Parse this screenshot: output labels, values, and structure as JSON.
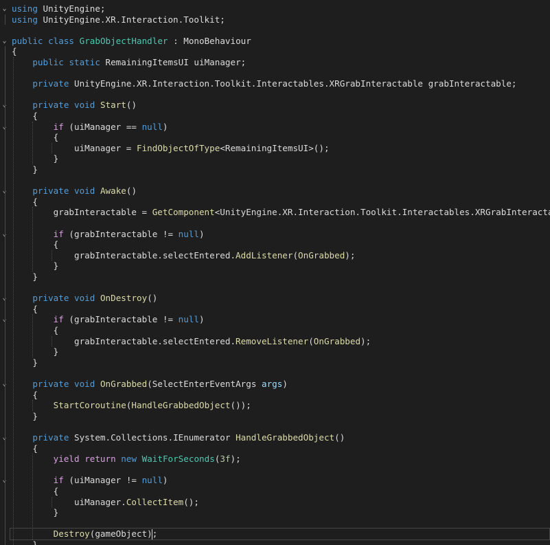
{
  "editor": {
    "lines": [
      {
        "fold": true,
        "tokens": [
          {
            "t": "using",
            "c": "kw"
          },
          {
            "t": " UnityEngine;",
            "c": "pl"
          }
        ]
      },
      {
        "tokens": [
          {
            "t": "using",
            "c": "kw"
          },
          {
            "t": " UnityEngine.XR.Interaction.Toolkit;",
            "c": "pl"
          }
        ]
      },
      {
        "tokens": []
      },
      {
        "fold": true,
        "tokens": [
          {
            "t": "public",
            "c": "kw"
          },
          {
            "t": " ",
            "c": "pl"
          },
          {
            "t": "class",
            "c": "kw"
          },
          {
            "t": " ",
            "c": "pl"
          },
          {
            "t": "GrabObjectHandler",
            "c": "type"
          },
          {
            "t": " : MonoBehaviour",
            "c": "pl"
          }
        ]
      },
      {
        "tokens": [
          {
            "t": "{",
            "c": "pl"
          }
        ]
      },
      {
        "tokens": [
          {
            "t": "    ",
            "c": "pl"
          },
          {
            "t": "public",
            "c": "kw"
          },
          {
            "t": " ",
            "c": "pl"
          },
          {
            "t": "static",
            "c": "kw"
          },
          {
            "t": " RemainingItemsUI uiManager;",
            "c": "pl"
          }
        ]
      },
      {
        "tokens": []
      },
      {
        "tokens": [
          {
            "t": "    ",
            "c": "pl"
          },
          {
            "t": "private",
            "c": "kw"
          },
          {
            "t": " UnityEngine.XR.Interaction.Toolkit.Interactables.XRGrabInteractable grabInteractable;",
            "c": "pl"
          }
        ]
      },
      {
        "tokens": []
      },
      {
        "fold": true,
        "tokens": [
          {
            "t": "    ",
            "c": "pl"
          },
          {
            "t": "private",
            "c": "kw"
          },
          {
            "t": " ",
            "c": "pl"
          },
          {
            "t": "void",
            "c": "kw"
          },
          {
            "t": " ",
            "c": "pl"
          },
          {
            "t": "Start",
            "c": "mth"
          },
          {
            "t": "()",
            "c": "pl"
          }
        ]
      },
      {
        "tokens": [
          {
            "t": "    {",
            "c": "pl"
          }
        ]
      },
      {
        "fold": true,
        "tokens": [
          {
            "t": "        ",
            "c": "pl"
          },
          {
            "t": "if",
            "c": "kw2"
          },
          {
            "t": " (uiManager == ",
            "c": "pl"
          },
          {
            "t": "null",
            "c": "kw"
          },
          {
            "t": ")",
            "c": "pl"
          }
        ]
      },
      {
        "tokens": [
          {
            "t": "        {",
            "c": "pl"
          }
        ]
      },
      {
        "tokens": [
          {
            "t": "            uiManager = ",
            "c": "pl"
          },
          {
            "t": "FindObjectOfType",
            "c": "mth"
          },
          {
            "t": "<RemainingItemsUI>();",
            "c": "pl"
          }
        ]
      },
      {
        "tokens": [
          {
            "t": "        }",
            "c": "pl"
          }
        ]
      },
      {
        "tokens": [
          {
            "t": "    }",
            "c": "pl"
          }
        ]
      },
      {
        "tokens": []
      },
      {
        "fold": true,
        "tokens": [
          {
            "t": "    ",
            "c": "pl"
          },
          {
            "t": "private",
            "c": "kw"
          },
          {
            "t": " ",
            "c": "pl"
          },
          {
            "t": "void",
            "c": "kw"
          },
          {
            "t": " ",
            "c": "pl"
          },
          {
            "t": "Awake",
            "c": "mth"
          },
          {
            "t": "()",
            "c": "pl"
          }
        ]
      },
      {
        "tokens": [
          {
            "t": "    {",
            "c": "pl"
          }
        ]
      },
      {
        "tokens": [
          {
            "t": "        grabInteractable = ",
            "c": "pl"
          },
          {
            "t": "GetComponent",
            "c": "mth"
          },
          {
            "t": "<UnityEngine.XR.Interaction.Toolkit.Interactables.XRGrabInteractable>();",
            "c": "pl"
          }
        ]
      },
      {
        "tokens": []
      },
      {
        "fold": true,
        "tokens": [
          {
            "t": "        ",
            "c": "pl"
          },
          {
            "t": "if",
            "c": "kw2"
          },
          {
            "t": " (grabInteractable != ",
            "c": "pl"
          },
          {
            "t": "null",
            "c": "kw"
          },
          {
            "t": ")",
            "c": "pl"
          }
        ]
      },
      {
        "tokens": [
          {
            "t": "        {",
            "c": "pl"
          }
        ]
      },
      {
        "tokens": [
          {
            "t": "            grabInteractable.selectEntered.",
            "c": "pl"
          },
          {
            "t": "AddListener",
            "c": "mth"
          },
          {
            "t": "(",
            "c": "pl"
          },
          {
            "t": "OnGrabbed",
            "c": "mth"
          },
          {
            "t": ");",
            "c": "pl"
          }
        ]
      },
      {
        "tokens": [
          {
            "t": "        }",
            "c": "pl"
          }
        ]
      },
      {
        "tokens": [
          {
            "t": "    }",
            "c": "pl"
          }
        ]
      },
      {
        "tokens": []
      },
      {
        "fold": true,
        "tokens": [
          {
            "t": "    ",
            "c": "pl"
          },
          {
            "t": "private",
            "c": "kw"
          },
          {
            "t": " ",
            "c": "pl"
          },
          {
            "t": "void",
            "c": "kw"
          },
          {
            "t": " ",
            "c": "pl"
          },
          {
            "t": "OnDestroy",
            "c": "mth"
          },
          {
            "t": "()",
            "c": "pl"
          }
        ]
      },
      {
        "tokens": [
          {
            "t": "    {",
            "c": "pl"
          }
        ]
      },
      {
        "fold": true,
        "tokens": [
          {
            "t": "        ",
            "c": "pl"
          },
          {
            "t": "if",
            "c": "kw2"
          },
          {
            "t": " (grabInteractable != ",
            "c": "pl"
          },
          {
            "t": "null",
            "c": "kw"
          },
          {
            "t": ")",
            "c": "pl"
          }
        ]
      },
      {
        "tokens": [
          {
            "t": "        {",
            "c": "pl"
          }
        ]
      },
      {
        "tokens": [
          {
            "t": "            grabInteractable.selectEntered.",
            "c": "pl"
          },
          {
            "t": "RemoveListener",
            "c": "mth"
          },
          {
            "t": "(",
            "c": "pl"
          },
          {
            "t": "OnGrabbed",
            "c": "mth"
          },
          {
            "t": ");",
            "c": "pl"
          }
        ]
      },
      {
        "tokens": [
          {
            "t": "        }",
            "c": "pl"
          }
        ]
      },
      {
        "tokens": [
          {
            "t": "    }",
            "c": "pl"
          }
        ]
      },
      {
        "tokens": []
      },
      {
        "fold": true,
        "tokens": [
          {
            "t": "    ",
            "c": "pl"
          },
          {
            "t": "private",
            "c": "kw"
          },
          {
            "t": " ",
            "c": "pl"
          },
          {
            "t": "void",
            "c": "kw"
          },
          {
            "t": " ",
            "c": "pl"
          },
          {
            "t": "OnGrabbed",
            "c": "mth"
          },
          {
            "t": "(SelectEnterEventArgs ",
            "c": "pl"
          },
          {
            "t": "args",
            "c": "param"
          },
          {
            "t": ")",
            "c": "pl"
          }
        ]
      },
      {
        "tokens": [
          {
            "t": "    {",
            "c": "pl"
          }
        ]
      },
      {
        "tokens": [
          {
            "t": "        ",
            "c": "pl"
          },
          {
            "t": "StartCoroutine",
            "c": "mth"
          },
          {
            "t": "(",
            "c": "pl"
          },
          {
            "t": "HandleGrabbedObject",
            "c": "mth"
          },
          {
            "t": "());",
            "c": "pl"
          }
        ]
      },
      {
        "tokens": [
          {
            "t": "    }",
            "c": "pl"
          }
        ]
      },
      {
        "tokens": []
      },
      {
        "fold": true,
        "tokens": [
          {
            "t": "    ",
            "c": "pl"
          },
          {
            "t": "private",
            "c": "kw"
          },
          {
            "t": " System.Collections.IEnumerator ",
            "c": "pl"
          },
          {
            "t": "HandleGrabbedObject",
            "c": "mth"
          },
          {
            "t": "()",
            "c": "pl"
          }
        ]
      },
      {
        "tokens": [
          {
            "t": "    {",
            "c": "pl"
          }
        ]
      },
      {
        "tokens": [
          {
            "t": "        ",
            "c": "pl"
          },
          {
            "t": "yield",
            "c": "kw2"
          },
          {
            "t": " ",
            "c": "pl"
          },
          {
            "t": "return",
            "c": "kw2"
          },
          {
            "t": " ",
            "c": "pl"
          },
          {
            "t": "new",
            "c": "kw"
          },
          {
            "t": " ",
            "c": "pl"
          },
          {
            "t": "WaitForSeconds",
            "c": "type"
          },
          {
            "t": "(",
            "c": "pl"
          },
          {
            "t": "3f",
            "c": "num"
          },
          {
            "t": ");",
            "c": "pl"
          }
        ]
      },
      {
        "tokens": []
      },
      {
        "fold": true,
        "tokens": [
          {
            "t": "        ",
            "c": "pl"
          },
          {
            "t": "if",
            "c": "kw2"
          },
          {
            "t": " (uiManager != ",
            "c": "pl"
          },
          {
            "t": "null",
            "c": "kw"
          },
          {
            "t": ")",
            "c": "pl"
          }
        ]
      },
      {
        "tokens": [
          {
            "t": "        {",
            "c": "pl"
          }
        ]
      },
      {
        "tokens": [
          {
            "t": "            uiManager.",
            "c": "pl"
          },
          {
            "t": "CollectItem",
            "c": "mth"
          },
          {
            "t": "();",
            "c": "pl"
          }
        ]
      },
      {
        "tokens": [
          {
            "t": "        }",
            "c": "pl"
          }
        ]
      },
      {
        "tokens": []
      },
      {
        "tokens": [
          {
            "t": "        ",
            "c": "pl"
          },
          {
            "t": "Destroy",
            "c": "mth"
          },
          {
            "t": "(gameObject); ",
            "c": "pl"
          }
        ]
      },
      {
        "tokens": [
          {
            "t": "    }",
            "c": "pl"
          }
        ]
      }
    ],
    "colors": {
      "background": "#1e1e1e",
      "keyword": "#569cd6",
      "control_keyword": "#d8a0df",
      "type": "#4ec9b0",
      "method": "#dcdcaa",
      "number": "#b5cea8",
      "plain": "#dcdcdc",
      "parameter": "#9cdcfe"
    },
    "fold_icon": "chevron-down-icon"
  }
}
